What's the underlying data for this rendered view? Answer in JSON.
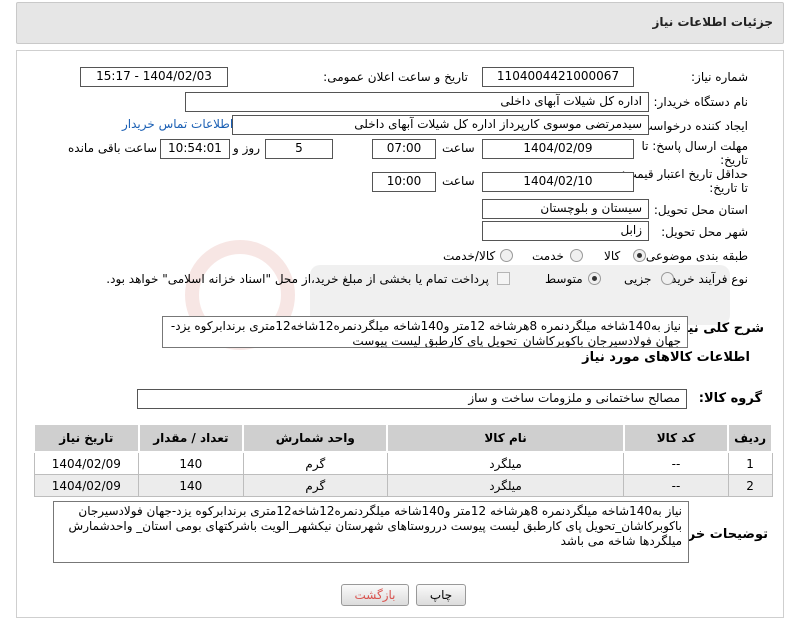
{
  "header": {
    "title": "جزئیات اطلاعات نیاز"
  },
  "form": {
    "need_number": {
      "label": "شماره نیاز:",
      "value": "1104004421000067"
    },
    "announce": {
      "label": "تاریخ و ساعت اعلان عمومی:",
      "value": "1404/02/03 - 15:17"
    },
    "buyer_org": {
      "label": "نام دستگاه خریدار:",
      "value": "اداره کل شیلات آبهای داخلی"
    },
    "requester": {
      "label": "ایجاد کننده درخواست:",
      "value": "سیدمرتضی موسوی کارپرداز اداره کل شیلات آبهای داخلی",
      "contact_link": "اطلاعات تماس خریدار"
    },
    "deadline": {
      "label_line1": "مهلت ارسال پاسخ: تا",
      "label_line2": "تاریخ:",
      "date": "1404/02/09",
      "time_label": "ساعت",
      "time": "07:00",
      "days": "5",
      "days_label": "روز و",
      "remaining": "10:54:01",
      "remaining_label": "ساعت باقی مانده"
    },
    "validity": {
      "label_line1": "حداقل تاریخ اعتبار قیمت:",
      "label_line2": "تا تاریخ:",
      "date": "1404/02/10",
      "time_label": "ساعت",
      "time": "10:00"
    },
    "province": {
      "label": "استان محل تحویل:",
      "value": "سیستان و بلوچستان"
    },
    "city": {
      "label": "شهر محل تحویل:",
      "value": "زابل"
    },
    "category": {
      "label": "طبقه بندی موضوعی:",
      "options": [
        "کالا",
        "خدمت",
        "کالا/خدمت"
      ],
      "selected": "کالا"
    },
    "process": {
      "label": "نوع فرآیند خرید :",
      "options": [
        "جزیی",
        "متوسط"
      ],
      "selected": "متوسط",
      "payment_note": "پرداخت تمام یا بخشی از مبلغ خرید،از محل \"اسناد خزانه اسلامی\" خواهد بود."
    },
    "description": {
      "label": "شرح کلی نیاز:",
      "value": "نیاز به140شاخه میلگردنمره 8هرشاخه 12متر و140شاخه میلگردنمره12شاخه12متری برندابرکوه یزد-جهان فولادسیرجان باکوبرکاشان_تحویل پای کارطبق لیست پیوست"
    }
  },
  "items_section": {
    "title": "اطلاعات کالاهای مورد نیاز",
    "group_label": "گروه کالا:",
    "group_value": "مصالح ساختمانی و ملزومات ساخت و ساز",
    "columns": [
      "ردیف",
      "کد کالا",
      "نام کالا",
      "واحد شمارش",
      "تعداد / مقدار",
      "تاریخ نیاز"
    ],
    "rows": [
      {
        "row": "1",
        "code": "--",
        "name": "میلگرد",
        "unit": "گرم",
        "qty": "140",
        "date": "1404/02/09"
      },
      {
        "row": "2",
        "code": "--",
        "name": "میلگرد",
        "unit": "گرم",
        "qty": "140",
        "date": "1404/02/09"
      }
    ]
  },
  "buyer_notes": {
    "label": "توضیحات خریدار:",
    "value": "نیاز به140شاخه میلگردنمره 8هرشاخه 12متر و140شاخه میلگردنمره12شاخه12متری برندابرکوه یزد-جهان فولادسیرجان باکوبرکاشان_تحویل پای کارطبق لیست پیوست درروستاهای شهرستان نیکشهر_الویت باشرکتهای بومی استان_ واحدشمارش میلگردها شاخه می باشد"
  },
  "buttons": {
    "print": "چاپ",
    "back": "بازگشت"
  },
  "colors": {
    "back_button": "#d9534f",
    "link": "#1a5fb4",
    "table_header": "#cfcfcf"
  }
}
